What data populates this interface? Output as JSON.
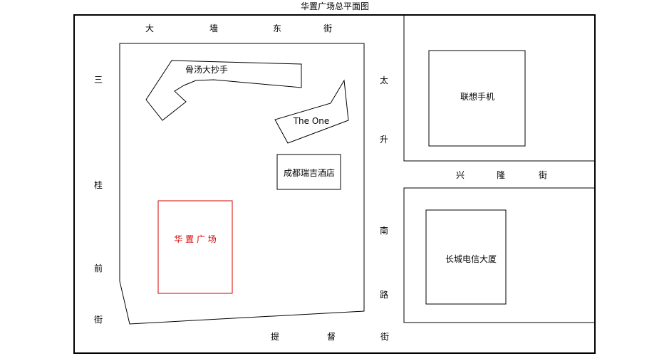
{
  "title": "华置广场总平面图",
  "streets": {
    "north": [
      "大",
      "墙",
      "东",
      "街"
    ],
    "west": [
      "三",
      "桂",
      "前",
      "街"
    ],
    "middle_vertical": [
      "太",
      "升",
      "南",
      "路"
    ],
    "east_horizontal": [
      "兴",
      "隆",
      "街"
    ],
    "south": [
      "提",
      "督",
      "街"
    ]
  },
  "buildings": {
    "gutang": "骨汤大抄手",
    "theone": "The One",
    "chengdu": "成都瑞吉酒店",
    "huazhi": "华 置 广 场",
    "lenovo": "联想手机",
    "greatwall": "长城电信大厦"
  },
  "colors": {
    "line": "#000000",
    "highlight": "#d40000"
  }
}
